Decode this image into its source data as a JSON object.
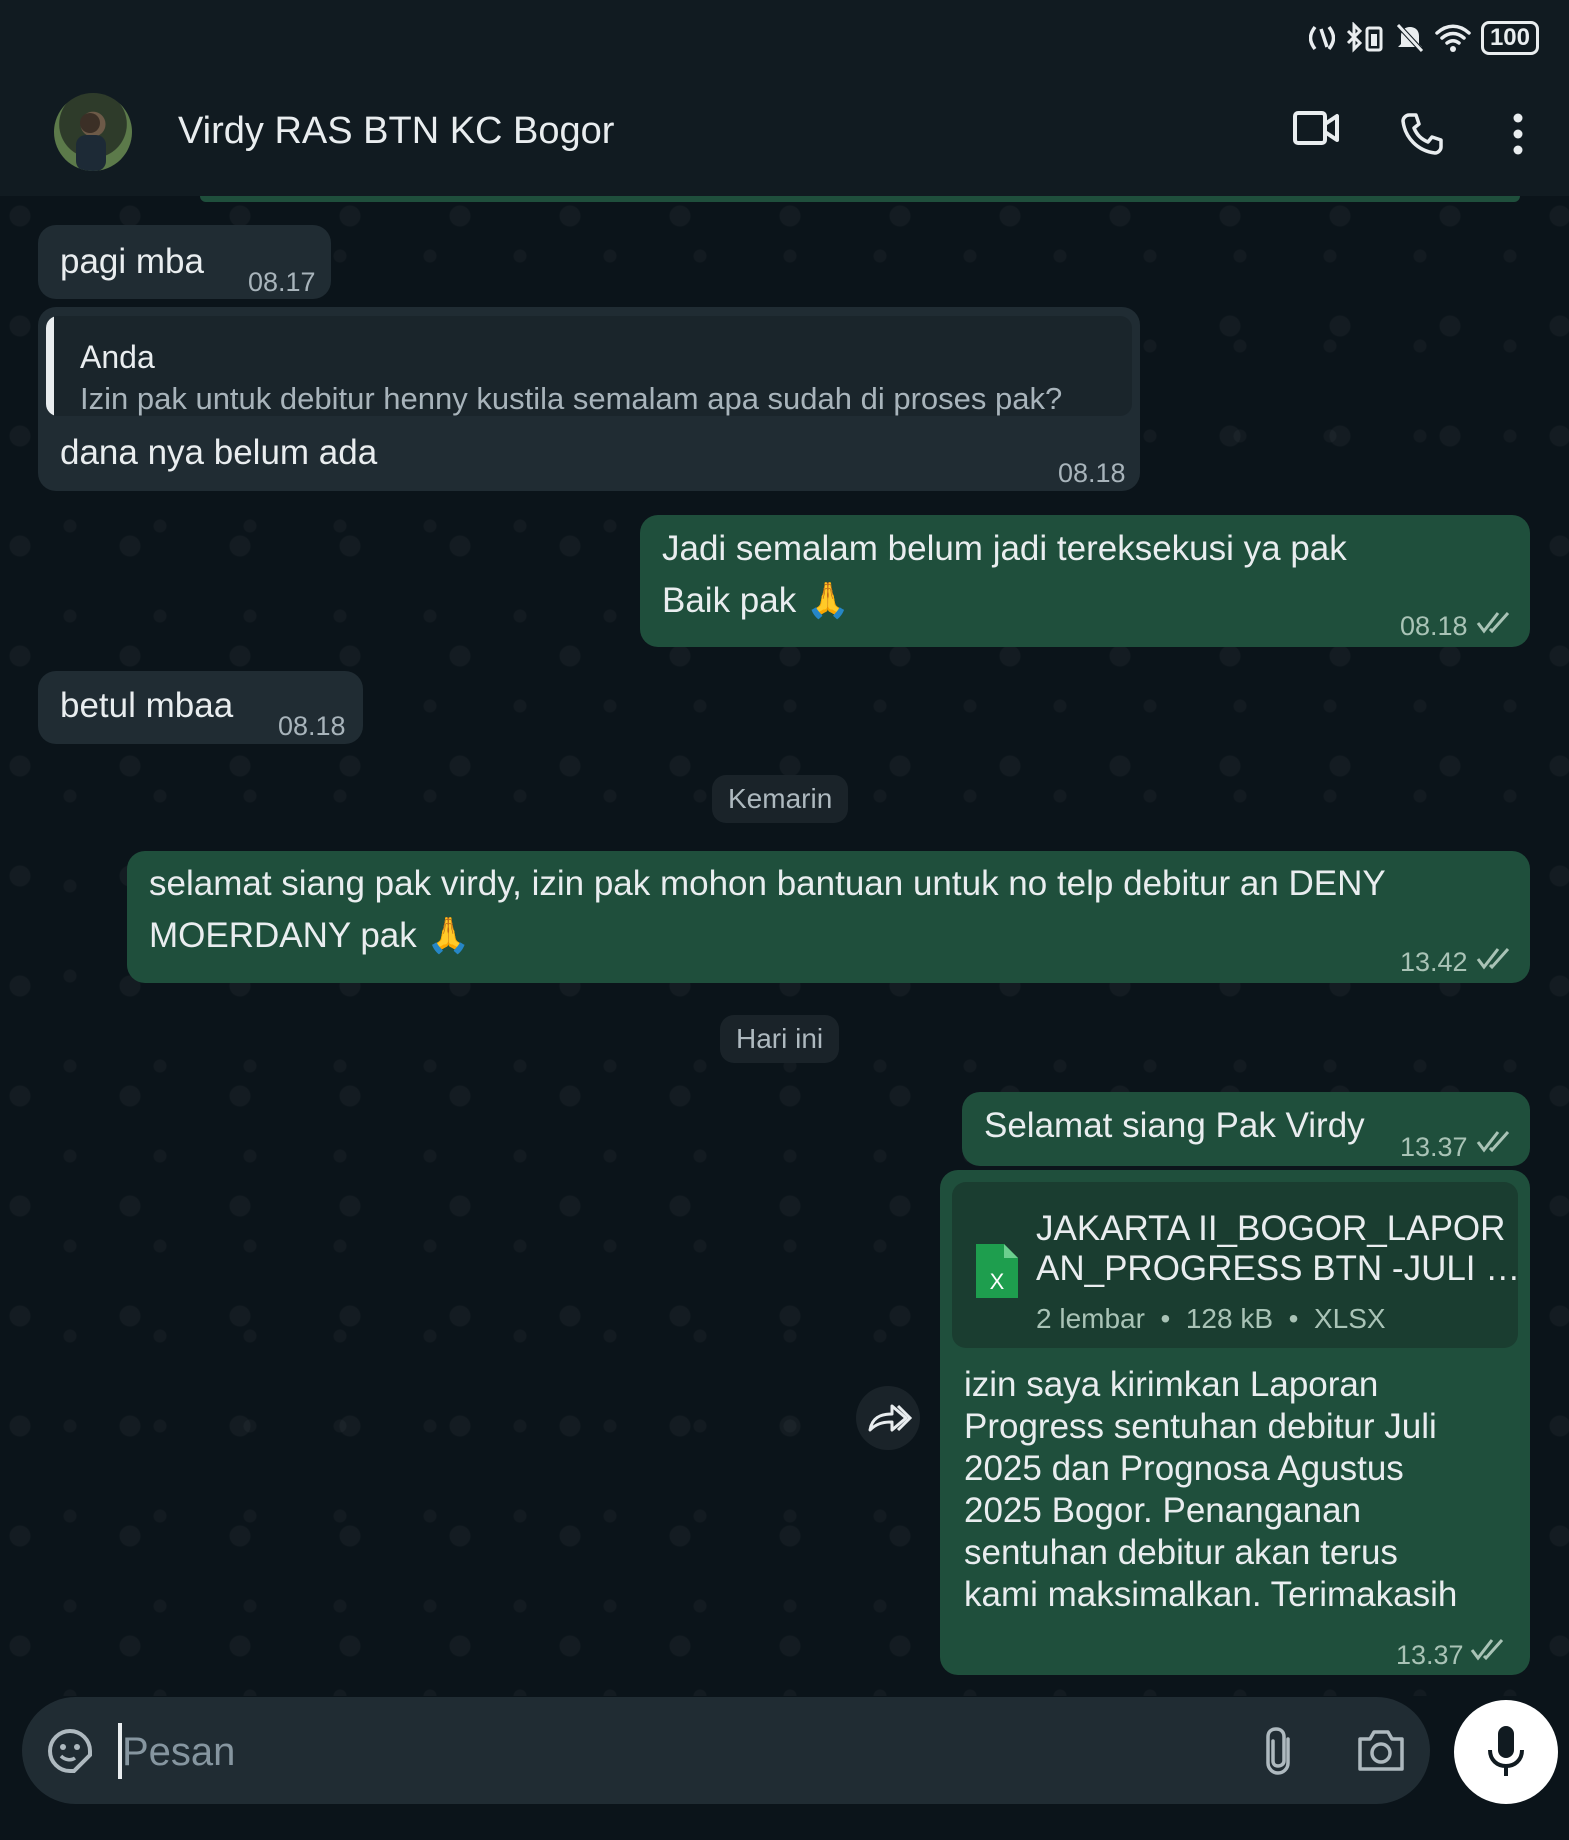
{
  "status_bar": {
    "battery": "100"
  },
  "header": {
    "contact_name": "Virdy RAS BTN KC Bogor"
  },
  "messages": {
    "m1": {
      "text": "pagi mba",
      "time": "08.17"
    },
    "m2": {
      "quote_author": "Anda",
      "quote_text": "Izin pak untuk debitur henny kustila semalam apa sudah di proses pak?",
      "text": "dana nya belum ada",
      "time": "08.18"
    },
    "m3": {
      "line1": "Jadi semalam belum jadi tereksekusi ya pak",
      "line2": "Baik pak",
      "emoji": "🙏",
      "time": "08.18"
    },
    "m4": {
      "text": "betul mbaa",
      "time": "08.18"
    },
    "day1": "Kemarin",
    "m5": {
      "line1": "selamat siang pak virdy, izin pak mohon bantuan untuk no telp debitur an DENY",
      "line2": "MOERDANY pak",
      "emoji": "🙏",
      "time": "13.42"
    },
    "day2": "Hari ini",
    "m6": {
      "text": "Selamat siang Pak Virdy",
      "time": "13.37"
    },
    "m7": {
      "file_name_line1": "JAKARTA II_BOGOR_LAPOR",
      "file_name_line2": "AN_PROGRESS BTN -JULI …",
      "file_pages": "2 lembar",
      "file_size": "128 kB",
      "file_type": "XLSX",
      "file_icon_letter": "X",
      "caption": [
        "izin saya kirimkan Laporan",
        "Progress sentuhan debitur Juli",
        "2025 dan Prognosa Agustus",
        "2025 Bogor. Penanganan",
        "sentuhan debitur akan terus",
        "kami maksimalkan. Terimakasih"
      ],
      "time": "13.37"
    }
  },
  "input": {
    "placeholder": "Pesan"
  },
  "colors": {
    "outgoing_bubble": "#1f4f3c",
    "incoming_bubble": "#202c33",
    "background": "#0b141a",
    "xlsx_green": "#1e9e4e"
  }
}
